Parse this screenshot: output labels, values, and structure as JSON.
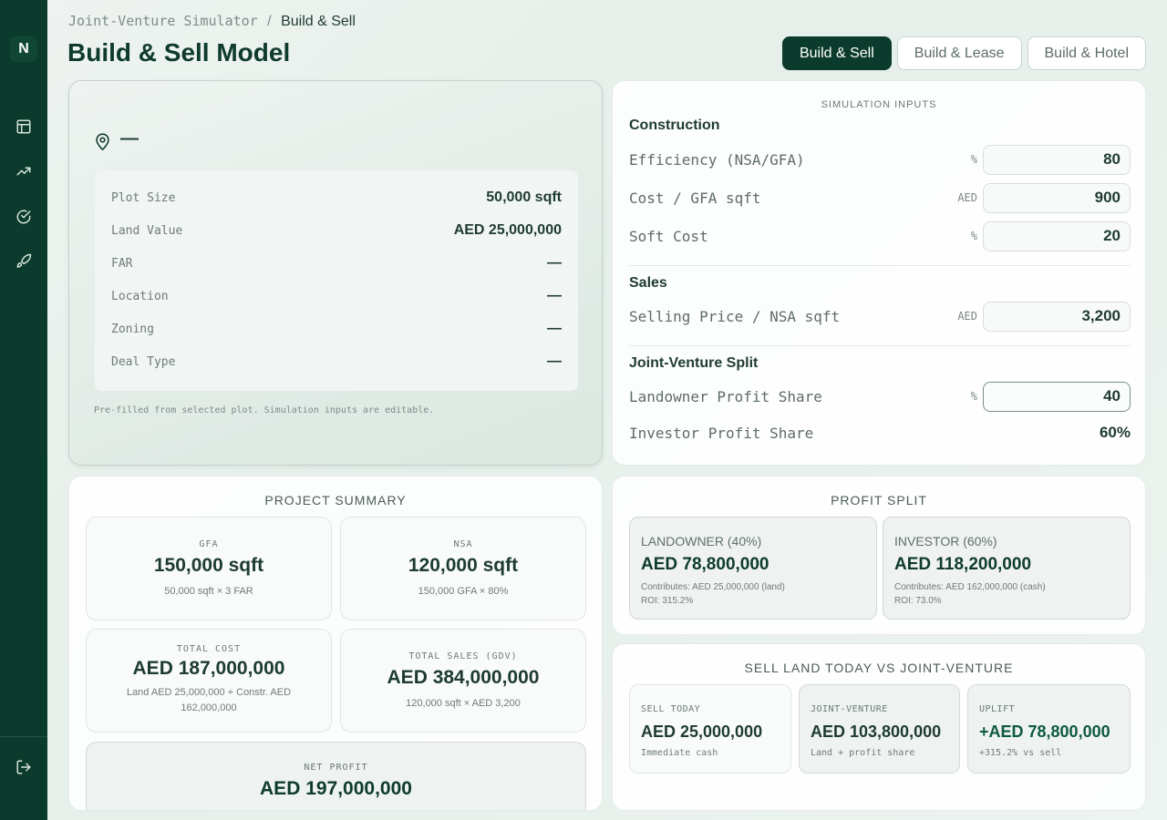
{
  "sidebar": {
    "logo": "N",
    "icons": [
      "layout-icon",
      "trending-up-icon",
      "check-circle-icon",
      "rocket-icon",
      "logout-icon"
    ]
  },
  "breadcrumb": {
    "root": "Joint-Venture Simulator",
    "separator": "/",
    "current": "Build & Sell"
  },
  "page": {
    "title": "Build & Sell Model"
  },
  "tabs": [
    {
      "label": "Build & Sell",
      "active": true
    },
    {
      "label": "Build & Lease",
      "active": false
    },
    {
      "label": "Build & Hotel",
      "active": false
    }
  ],
  "plot": {
    "title": "—",
    "rows": [
      {
        "label": "Plot Size",
        "value": "50,000 sqft"
      },
      {
        "label": "Land Value",
        "value": "AED 25,000,000"
      },
      {
        "label": "FAR",
        "value": "—"
      },
      {
        "label": "Location",
        "value": "—"
      },
      {
        "label": "Zoning",
        "value": "—"
      },
      {
        "label": "Deal Type",
        "value": "—"
      }
    ],
    "note": "Pre-filled from selected plot. Simulation inputs are editable."
  },
  "inputs": {
    "caption": "SIMULATION INPUTS",
    "construction": {
      "title": "Construction",
      "efficiency": {
        "label": "Efficiency (NSA/GFA)",
        "unit": "%",
        "value": "80"
      },
      "cost": {
        "label": "Cost / GFA sqft",
        "unit": "AED",
        "value": "900"
      },
      "soft": {
        "label": "Soft Cost",
        "unit": "%",
        "value": "20"
      }
    },
    "sales": {
      "title": "Sales",
      "price": {
        "label": "Selling Price / NSA sqft",
        "unit": "AED",
        "value": "3,200"
      }
    },
    "jv": {
      "title": "Joint-Venture Split",
      "landowner": {
        "label": "Landowner Profit Share",
        "unit": "%",
        "value": "40"
      },
      "investor": {
        "label": "Investor Profit Share",
        "value": "60%"
      }
    }
  },
  "summary": {
    "title": "PROJECT SUMMARY",
    "gfa": {
      "caption": "GFA",
      "value": "150,000 sqft",
      "sub": "50,000 sqft × 3 FAR"
    },
    "nsa": {
      "caption": "NSA",
      "value": "120,000 sqft",
      "sub": "150,000 GFA × 80%"
    },
    "cost": {
      "caption": "TOTAL COST",
      "value": "AED 187,000,000",
      "sub": "Land AED 25,000,000 + Constr. AED 162,000,000"
    },
    "gdv": {
      "caption": "TOTAL SALES (GDV)",
      "value": "AED 384,000,000",
      "sub": "120,000 sqft × AED 3,200"
    },
    "net": {
      "caption": "NET PROFIT",
      "value": "AED 197,000,000"
    }
  },
  "split": {
    "title": "PROFIT SPLIT",
    "landowner": {
      "caption": "LANDOWNER (40%)",
      "value": "AED 78,800,000",
      "contrib": "Contributes: AED 25,000,000 (land)",
      "roi": "ROI: 315.2%"
    },
    "investor": {
      "caption": "INVESTOR (60%)",
      "value": "AED 118,200,000",
      "contrib": "Contributes: AED 162,000,000 (cash)",
      "roi": "ROI: 73.0%"
    }
  },
  "compare": {
    "title": "SELL LAND TODAY VS JOINT-VENTURE",
    "sell": {
      "caption": "SELL TODAY",
      "value": "AED 25,000,000",
      "sub": "Immediate cash"
    },
    "jv": {
      "caption": "JOINT-VENTURE",
      "value": "AED 103,800,000",
      "sub": "Land + profit share"
    },
    "uplift": {
      "caption": "UPLIFT",
      "value": "+AED 78,800,000",
      "sub": "+315.2% vs sell"
    }
  },
  "colors": {
    "sidebar": "#0b3b2c",
    "accent": "#0e3b2c",
    "background": "#eaf1ed"
  }
}
